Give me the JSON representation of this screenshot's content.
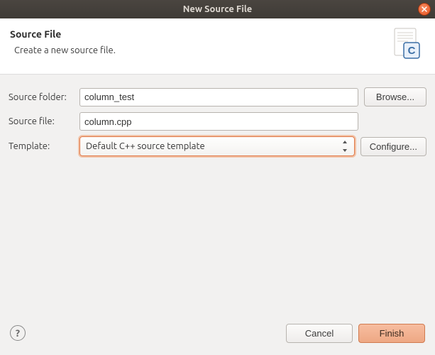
{
  "window": {
    "title": "New Source File"
  },
  "header": {
    "title": "Source File",
    "subtitle": "Create a new source file."
  },
  "form": {
    "source_folder_label": "Source folder:",
    "source_folder_value": "column_test",
    "browse_label": "Browse...",
    "source_file_label": "Source file:",
    "source_file_value": "column.cpp",
    "template_label": "Template:",
    "template_value": "Default C++ source template",
    "configure_label": "Configure..."
  },
  "footer": {
    "help": "?",
    "cancel": "Cancel",
    "finish": "Finish"
  }
}
